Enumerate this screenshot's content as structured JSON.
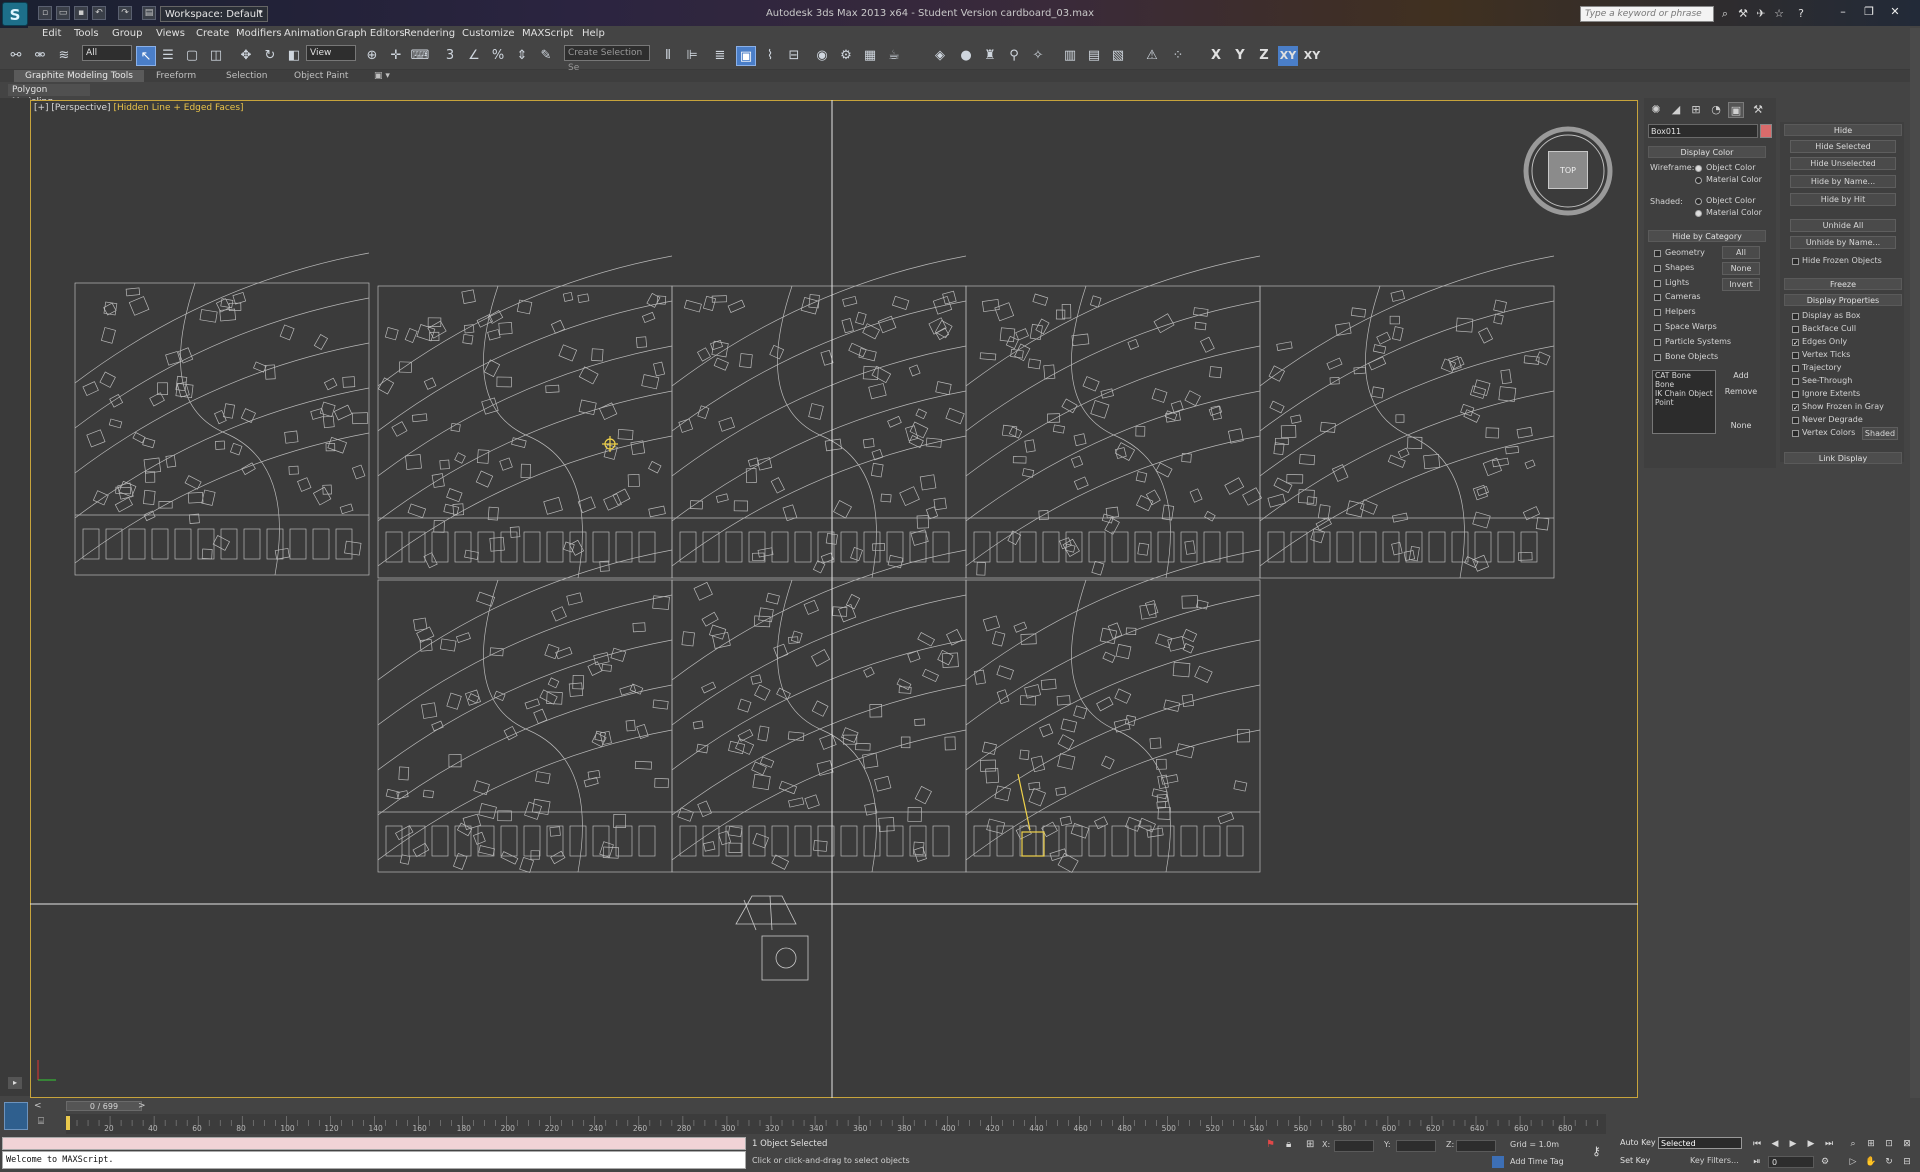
{
  "titlebar": {
    "app_logo": "S",
    "workspace": "Workspace: Default",
    "title": "Autodesk 3ds Max 2013 x64 - Student Version   cardboard_03.max",
    "search_placeholder": "Type a keyword or phrase",
    "window_buttons": [
      "–",
      "❐",
      "✕"
    ]
  },
  "menu": [
    "Edit",
    "Tools",
    "Group",
    "Views",
    "Create",
    "Modifiers",
    "Animation",
    "Graph Editors",
    "Rendering",
    "Customize",
    "MAXScript",
    "Help"
  ],
  "toolbar": {
    "filter_combo": "All",
    "refcoord_combo": "View",
    "selection_set": "Create Selection Se",
    "axes": [
      "X",
      "Y",
      "Z",
      "XY",
      "XY"
    ]
  },
  "ribbon": {
    "tabs": [
      "Graphite Modeling Tools",
      "Freeform",
      "Selection",
      "Object Paint"
    ],
    "panel_label": "Polygon Modeling"
  },
  "viewport": {
    "label_prefix": "[+] [Perspective] ",
    "label_shading": "[Hidden Line + Edged Faces]",
    "viewcube_face": "TOP",
    "accent_color": "#c7a43c"
  },
  "command_panel": {
    "object_name": "Box011",
    "object_color": "#d96b6b",
    "display_color": {
      "header": "Display Color",
      "wireframe_label": "Wireframe:",
      "shaded_label": "Shaded:",
      "object_color": "Object Color",
      "material_color": "Material Color"
    },
    "hide_by_category": {
      "header": "Hide by Category",
      "items": [
        "Geometry",
        "Shapes",
        "Lights",
        "Cameras",
        "Helpers",
        "Space Warps",
        "Particle Systems",
        "Bone Objects"
      ],
      "buttons": [
        "All",
        "None",
        "Invert"
      ],
      "list": [
        "CAT Bone",
        "Bone",
        "IK Chain Object",
        "Point"
      ],
      "list_buttons": [
        "Add",
        "Remove",
        "None"
      ]
    }
  },
  "display_panel": {
    "hide": {
      "header": "Hide",
      "buttons": [
        "Hide Selected",
        "Hide Unselected",
        "Hide by Name...",
        "Hide by Hit",
        "Unhide All",
        "Unhide by Name..."
      ],
      "frozen_label": "Hide Frozen Objects"
    },
    "freeze_header": "Freeze",
    "display_properties": {
      "header": "Display Properties",
      "items": [
        {
          "label": "Display as Box",
          "checked": false
        },
        {
          "label": "Backface Cull",
          "checked": false
        },
        {
          "label": "Edges Only",
          "checked": true
        },
        {
          "label": "Vertex Ticks",
          "checked": false
        },
        {
          "label": "Trajectory",
          "checked": false
        },
        {
          "label": "See-Through",
          "checked": false
        },
        {
          "label": "Ignore Extents",
          "checked": false
        },
        {
          "label": "Show Frozen in Gray",
          "checked": true
        },
        {
          "label": "Never Degrade",
          "checked": false
        },
        {
          "label": "Vertex Colors",
          "checked": false
        }
      ],
      "shaded_button": "Shaded"
    },
    "link_display_header": "Link Display"
  },
  "timeline": {
    "slider": "0 / 699",
    "ticks": [
      "20",
      "40",
      "60",
      "80",
      "100",
      "120",
      "140",
      "160",
      "180",
      "200",
      "220",
      "240",
      "260",
      "280",
      "300",
      "320",
      "340",
      "360",
      "380",
      "400",
      "420",
      "440",
      "460",
      "480",
      "500",
      "520",
      "540",
      "560",
      "580",
      "600",
      "620",
      "640",
      "660",
      "680"
    ]
  },
  "status": {
    "maxscript": "Welcome to MAXScript.",
    "selected": "1 Object Selected",
    "prompt": "Click or click-and-drag to select objects",
    "x_label": "X:",
    "y_label": "Y:",
    "z_label": "Z:",
    "grid": "Grid = 1.0m",
    "add_time_tag": "Add Time Tag",
    "auto_key": "Auto Key",
    "set_key": "Set Key",
    "selected_combo": "Selected",
    "key_filters": "Key Filters...",
    "frame": "0"
  }
}
